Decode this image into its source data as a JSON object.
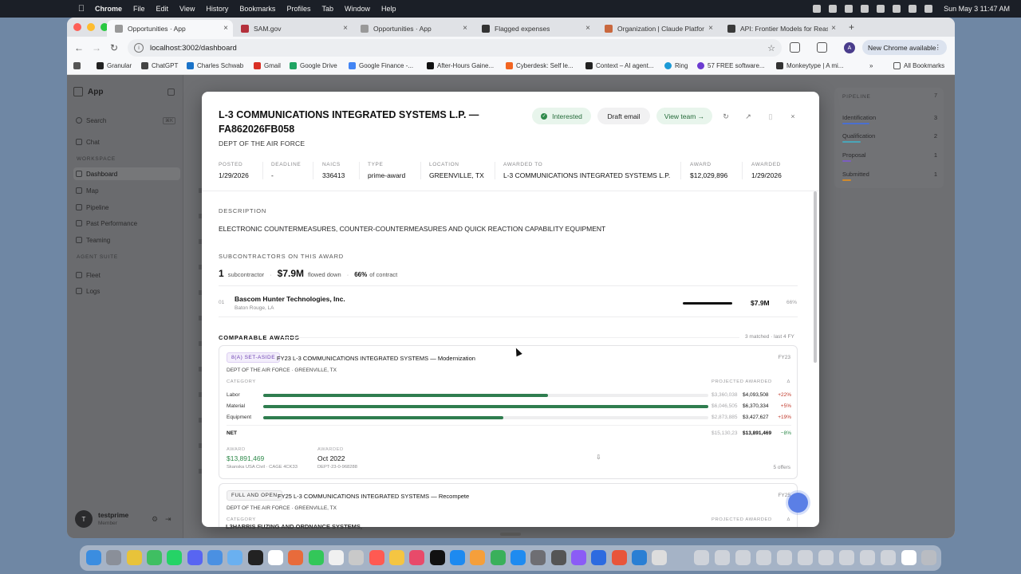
{
  "menubar": {
    "app": "Chrome",
    "items": [
      "File",
      "Edit",
      "View",
      "History",
      "Bookmarks",
      "Profiles",
      "Tab",
      "Window",
      "Help"
    ],
    "datetime": "Sun May 3  11:47 AM"
  },
  "browser": {
    "tabs": [
      {
        "label": "Opportunities · App",
        "icon_color": "#8a8a8d"
      },
      {
        "label": "SAM.gov",
        "icon_color": "#b4303b"
      },
      {
        "label": "Opportunities · App",
        "icon_color": "#8a8a8d"
      },
      {
        "label": "Flagged expenses",
        "icon_color": "#333333"
      },
      {
        "label": "Organization | Claude Platfor",
        "icon_color": "#c9683e"
      },
      {
        "label": "API: Frontier Models for Reas",
        "icon_color": "#3a3a3a"
      }
    ],
    "url": "localhost:3002/dashboard",
    "new_chrome": "New Chrome available",
    "profile_initial": "A",
    "bookmarks": [
      "Granular",
      "ChatGPT",
      "Charles Schwab",
      "Gmail",
      "Google Drive",
      "Google Finance -...",
      "After-Hours Gaine...",
      "Cyberdesk: Self le...",
      "Context – AI agent...",
      "Ring",
      "57 FREE software...",
      "Monkeytype | A mi..."
    ],
    "all_bookmarks": "All Bookmarks"
  },
  "sidebar": {
    "app_name": "App",
    "search": "Search",
    "search_kbd": "⌘K",
    "chat": "Chat",
    "workspace_label": "WORKSPACE",
    "workspace": [
      "Dashboard",
      "Map",
      "Pipeline",
      "Past Performance",
      "Teaming"
    ],
    "agent_label": "AGENT SUITE",
    "agent": [
      "Fleet",
      "Logs"
    ],
    "user_name": "testprime",
    "user_role": "Member",
    "user_initial": "T"
  },
  "pipeline": {
    "title": "PIPELINE",
    "total": "7",
    "rows": [
      {
        "label": "Identification",
        "count": "3",
        "color": "#4a6fd0",
        "fraction": 0.43
      },
      {
        "label": "Qualification",
        "count": "2",
        "color": "#4aa5b8",
        "fraction": 0.29
      },
      {
        "label": "Proposal",
        "count": "1",
        "color": "#7b5ec0",
        "fraction": 0.14
      },
      {
        "label": "Submitted",
        "count": "1",
        "color": "#d18b2c",
        "fraction": 0.14
      }
    ]
  },
  "modal": {
    "title": "L-3 COMMUNICATIONS INTEGRATED SYSTEMS L.P. — FA862026FB058",
    "agency": "DEPT OF THE AIR FORCE",
    "interested": "Interested",
    "draft_email": "Draft email",
    "view_team": "View team →",
    "meta": [
      {
        "label": "POSTED",
        "value": "1/29/2026"
      },
      {
        "label": "DEADLINE",
        "value": "-"
      },
      {
        "label": "NAICS",
        "value": "336413"
      },
      {
        "label": "TYPE",
        "value": "prime-award"
      },
      {
        "label": "LOCATION",
        "value": "GREENVILLE, TX"
      },
      {
        "label": "AWARDED TO",
        "value": "L-3 COMMUNICATIONS INTEGRATED SYSTEMS L.P."
      },
      {
        "label": "AWARD",
        "value": "$12,029,896"
      },
      {
        "label": "AWARDED",
        "value": "1/29/2026"
      }
    ],
    "description_label": "DESCRIPTION",
    "description": "ELECTRONIC COUNTERMEASURES, COUNTER-COUNTERMEASURES AND QUICK REACTION CAPABILITY EQUIPMENT",
    "subs_label": "SUBCONTRACTORS ON THIS AWARD",
    "subs_count": "1",
    "subs_count_label": "subcontractor",
    "subs_flowed": "$7.9M",
    "subs_flowed_label": "flowed down",
    "subs_pct": "66%",
    "subs_pct_label": "of contract",
    "sub": {
      "index": "01",
      "name": "Bascom Hunter Technologies, Inc.",
      "location": "Baton Rouge, LA",
      "value": "$7.9M",
      "pct": "66%",
      "share": 0.66
    },
    "comparable_label": "COMPARABLE AWARDS",
    "comparable_meta": "3 matched · last 4 FY",
    "cards": [
      {
        "badge": "8(A) SET-ASIDE",
        "title": "FY23 L-3 COMMUNICATIONS INTEGRATED SYSTEMS — Modernization",
        "fy": "FY23",
        "sub": "DEPT OF THE AIR FORCE · GREENVILLE, TX",
        "head_category": "CATEGORY",
        "head_proj": "PROJECTED AWARDED",
        "head_delta": "Δ",
        "rows": [
          {
            "name": "Labor",
            "projected": "$3,360,038",
            "awarded": "$4,093,508",
            "delta": "+22%",
            "fill": 0.64
          },
          {
            "name": "Material",
            "projected": "$6,046,505",
            "awarded": "$6,370,334",
            "delta": "+5%",
            "fill": 1.0
          },
          {
            "name": "Equipment",
            "projected": "$2,873,885",
            "awarded": "$3,427,627",
            "delta": "+19%",
            "fill": 0.54
          }
        ],
        "net_label": "NET",
        "net_projected": "$15,130,23",
        "net_awarded": "$13,891,469",
        "net_delta": "−8%",
        "award_label": "AWARD",
        "award_value": "$13,891,469",
        "award_company": "Skanska USA Civil · CAGE 4CK33",
        "awarded_label": "AWARDED",
        "awarded_value": "Oct 2022",
        "awarded_id": "DEPT-23-0-968288",
        "offers": "5 offers"
      },
      {
        "badge": "FULL AND OPEN",
        "title": "FY25 L-3 COMMUNICATIONS INTEGRATED SYSTEMS — Recompete",
        "fy": "FY25",
        "sub": "DEPT OF THE AIR FORCE · GREENVILLE, TX",
        "head_category": "CATEGORY",
        "head_proj": "PROJECTED AWARDED",
        "head_delta": "Δ"
      }
    ],
    "bg_text": "L3HARRIS FUZING AND ORDNANCE SYSTEMS,"
  }
}
